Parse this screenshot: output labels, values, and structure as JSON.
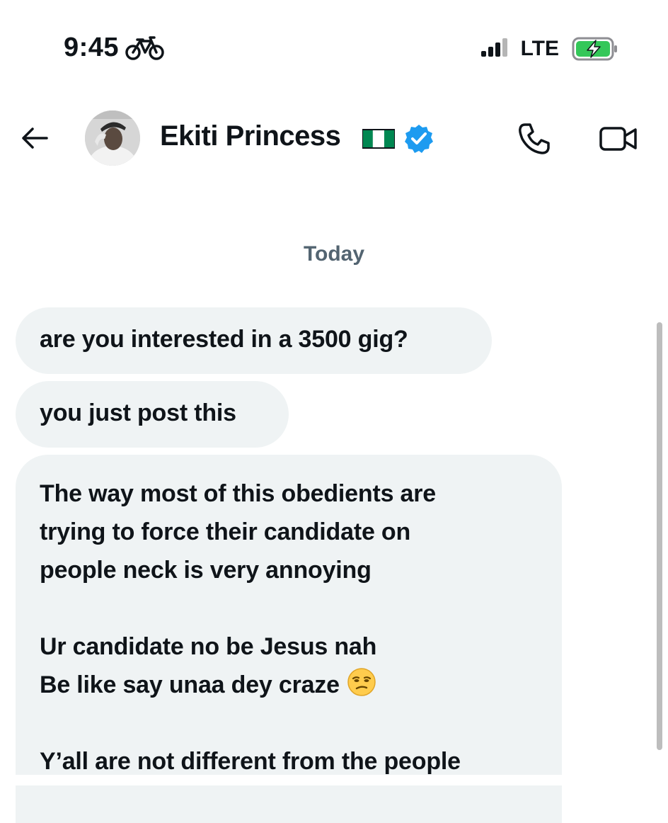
{
  "status_bar": {
    "time": "9:45",
    "network": "LTE",
    "icons": [
      "bike-icon",
      "signal-icon",
      "battery-charging-icon"
    ]
  },
  "header": {
    "contact_name": "Ekiti Princess",
    "flag": "nigeria-flag-icon",
    "verified": true,
    "accent_color": "#1d9bf0",
    "actions": [
      "back-icon",
      "call-icon",
      "video-call-icon"
    ]
  },
  "conversation": {
    "date_separator": "Today",
    "messages": [
      {
        "text": "are you interested in a 3500 gig?"
      },
      {
        "text": "you just post this"
      },
      {
        "lines": [
          "The way most of this obedients are",
          "trying to force their candidate on",
          "people neck is very annoying",
          "",
          "Ur candidate no be Jesus nah",
          "Be like say unaa dey craze",
          "",
          "Y’all are not different from the people"
        ],
        "emoji": "unamused-face-icon"
      }
    ]
  },
  "colors": {
    "bubble_bg": "#eff3f4",
    "text": "#0f1419",
    "muted": "#536471",
    "battery_green": "#34c759"
  }
}
